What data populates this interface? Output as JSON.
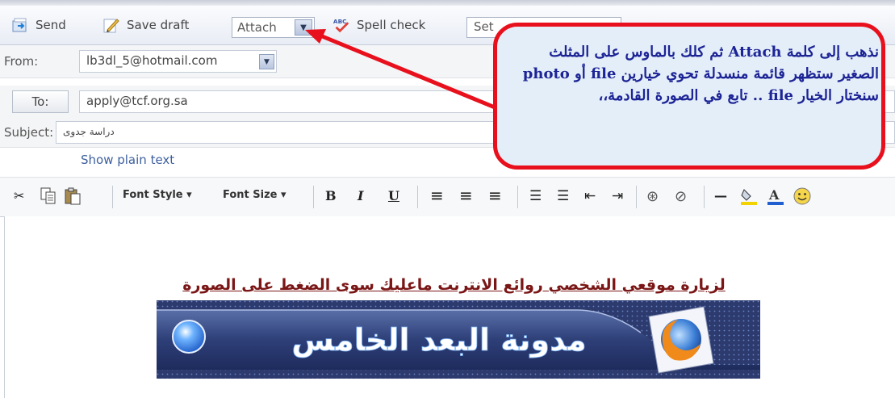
{
  "toolbar": {
    "send_label": "Send",
    "save_draft_label": "Save draft",
    "attach_label": "Attach",
    "spell_check_label": "Spell check",
    "select_value": "Set"
  },
  "compose": {
    "from_label": "From:",
    "from_value": "lb3dl_5@hotmail.com",
    "to_button_label": "To:",
    "to_value": "apply@tcf.org.sa",
    "subject_label": "Subject:",
    "subject_value": "دراسة جدوى",
    "show_plain_text_label": "Show plain text"
  },
  "format_toolbar": {
    "font_style_label": "Font Style ▾",
    "font_size_label": "Font Size ▾",
    "bold_label": "B",
    "italic_label": "I",
    "underline_label": "U"
  },
  "body": {
    "visit_link_text": "لزيارة موقعي الشخصي روائع الانترنت ماعليك سوى الضغط على الصورة",
    "banner_text": "مدونة البعد الخامس"
  },
  "callout": {
    "text": "نذهب إلى كلمة Attach ثم كلك بالماوس على المثلث الصغير ستظهر قائمة منسدلة تحوي خيارين file أو photo سنختار الخيار file .. تابع في الصورة القادمة،،"
  },
  "colors": {
    "callout_border": "#e8101c",
    "callout_text": "#1c2496",
    "link": "#3d5f9e",
    "body_link": "#7a1616"
  }
}
